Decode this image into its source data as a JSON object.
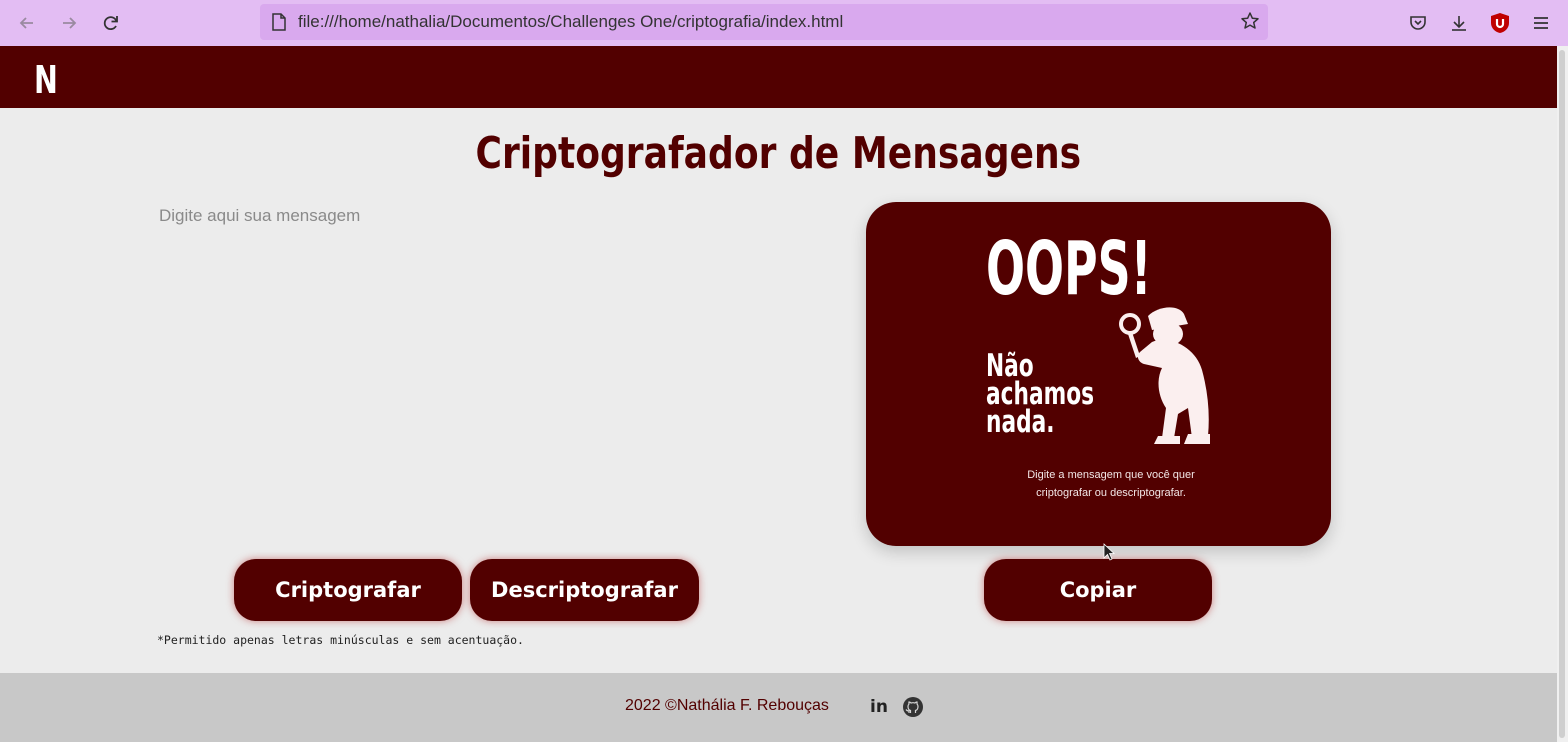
{
  "browser": {
    "url": "file:///home/nathalia/Documentos/Challenges One/criptografia/index.html"
  },
  "header": {
    "logo": "N"
  },
  "main": {
    "title": "Criptografador de Mensagens",
    "input_placeholder": "Digite aqui sua mensagem",
    "buttons": {
      "encrypt": "Criptografar",
      "decrypt": "Descriptografar",
      "copy": "Copiar"
    },
    "note": "*Permitido apenas letras minúsculas e sem acentuação."
  },
  "result_card": {
    "heading": "OOPS!",
    "not_found_lines": [
      "Não",
      "achamos",
      "nada."
    ],
    "hint_lines": [
      "Digite a mensagem que você quer",
      "criptografar ou descriptografar."
    ]
  },
  "footer": {
    "text": "2022 ©Nathália F. Rebouças",
    "linkedin": "in"
  },
  "icons": {
    "back": "arrow-left-icon",
    "forward": "arrow-right-icon",
    "reload": "reload-icon",
    "page": "page-icon",
    "bookmark": "star-icon",
    "pocket": "pocket-icon",
    "download": "download-icon",
    "extension": "ublock-icon",
    "menu": "hamburger-menu-icon",
    "linkedin": "linkedin-icon",
    "github": "github-icon",
    "detective": "detective-icon"
  },
  "colors": {
    "brand": "#520000",
    "browser_chrome": "#e3bdf3",
    "page_bg": "#ececec",
    "footer_bg": "#c8c8c8"
  }
}
